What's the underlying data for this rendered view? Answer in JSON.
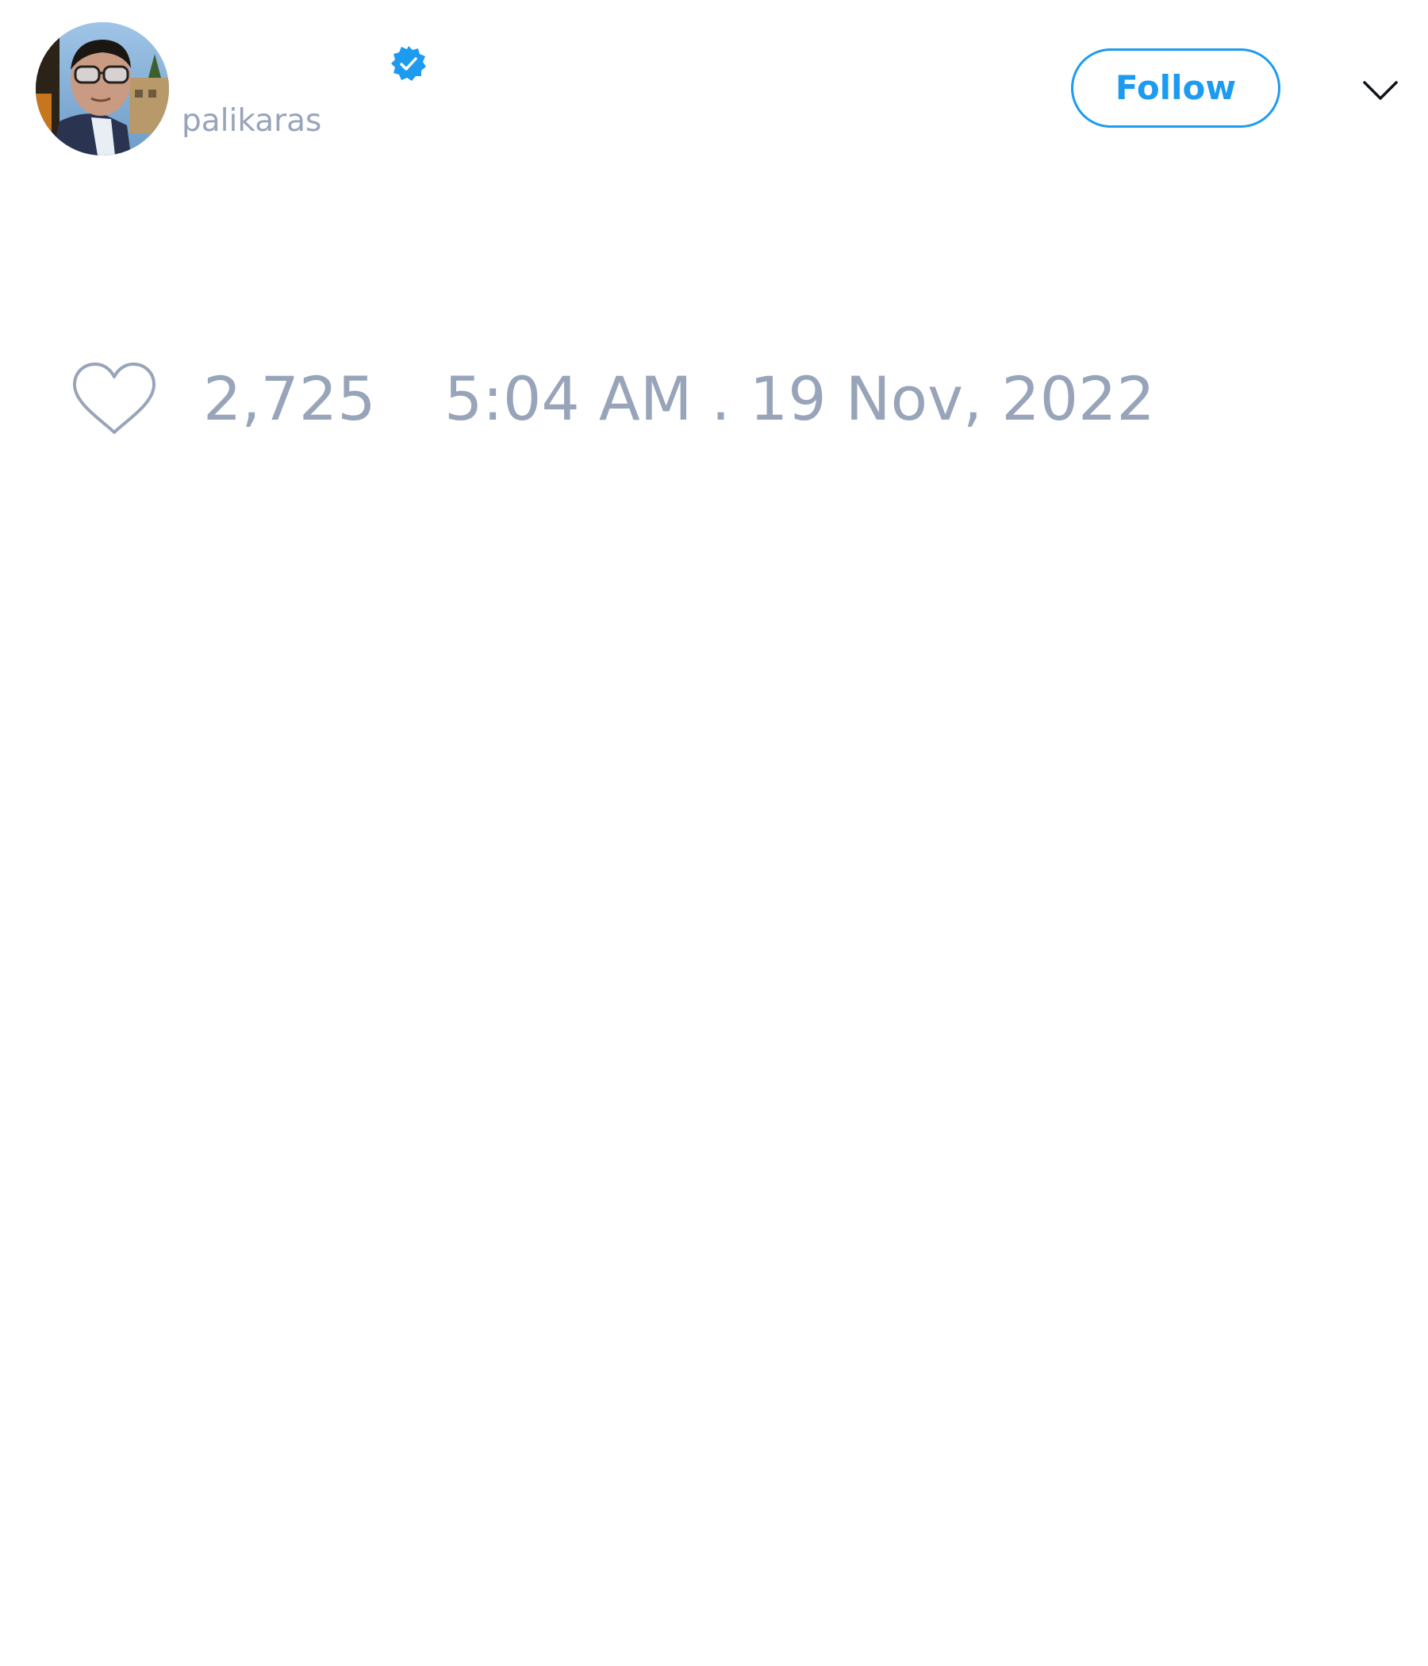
{
  "tweet": {
    "author": {
      "display_name": "",
      "handle": "palikaras",
      "verified": true,
      "avatar_icon": "user-avatar-photo"
    },
    "follow_button": {
      "label": "Follow"
    },
    "menu": {
      "icon": "chevron-down-icon"
    },
    "likes": {
      "icon": "heart-outline-icon",
      "count": "2,725"
    },
    "timestamp": "5:04 AM . 19 Nov, 2022"
  },
  "colors": {
    "accent": "#1d9bf0",
    "muted_text": "#98a4b9",
    "background": "#ffffff"
  }
}
